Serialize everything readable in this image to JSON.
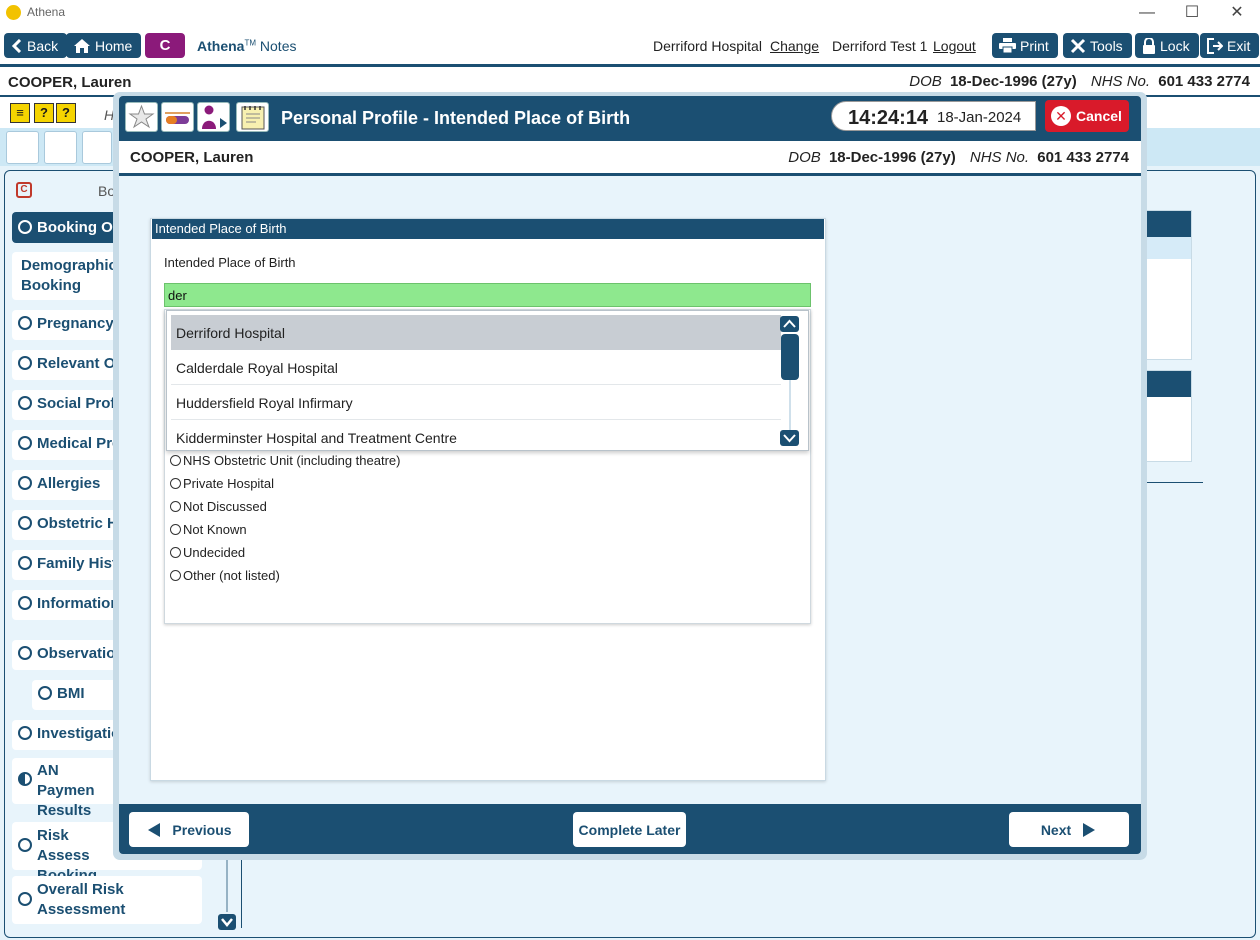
{
  "window": {
    "title": "Athena",
    "controls": {
      "minimize": "—",
      "maximize": "☐",
      "close": "✕"
    }
  },
  "toolbar": {
    "back_label": "Back",
    "home_label": "Home",
    "c_label": "C",
    "brand_name": "Athena",
    "brand_tm": "TM",
    "brand_suffix": "Notes",
    "hospital": "Derriford Hospital",
    "change_link": "Change",
    "user": "Derriford Test 1",
    "logout_link": "Logout",
    "print_label": "Print",
    "tools_label": "Tools",
    "lock_label": "Lock",
    "exit_label": "Exit"
  },
  "patient": {
    "name": "COOPER, Lauren",
    "dob_label": "DOB",
    "dob_value": "18-Dec-1996 (27y)",
    "nhs_label": "NHS No.",
    "nhs_value": "601 433 2774"
  },
  "background": {
    "c_badge": "C",
    "heading_fragment": "Bo",
    "h_fragment": "H",
    "nav_items": [
      {
        "label": "Booking Ov",
        "state": "active"
      },
      {
        "label": "Demographics Booking",
        "state": "none"
      },
      {
        "label": "Pregnancy I",
        "state": "empty"
      },
      {
        "label": "Relevant Ot",
        "state": "empty"
      },
      {
        "label": "Social Profil",
        "state": "empty"
      },
      {
        "label": "Medical Pro",
        "state": "empty"
      },
      {
        "label": "Allergies",
        "state": "empty"
      },
      {
        "label": "Obstetric H",
        "state": "empty"
      },
      {
        "label": "Family Histo",
        "state": "empty"
      },
      {
        "label": "Information",
        "state": "empty"
      },
      {
        "label": "Observation",
        "state": "empty"
      },
      {
        "label": "BMI",
        "state": "empty"
      },
      {
        "label": "Investigatio",
        "state": "empty"
      },
      {
        "label": "AN Paymen Results",
        "state": "half"
      },
      {
        "label": "Risk Assess Booking",
        "state": "empty"
      },
      {
        "label": "Overall Risk Assessment",
        "state": "empty"
      }
    ]
  },
  "modal": {
    "title": "Personal Profile - Intended Place of Birth",
    "time": "14:24:14",
    "date": "18-Jan-2024",
    "cancel_label": "Cancel",
    "card_header": "Intended Place of Birth",
    "field_label": "Intended Place of Birth",
    "search_value": "der",
    "dropdown_items": [
      "Derriford Hospital",
      "Calderdale Royal Hospital",
      "Huddersfield Royal Infirmary",
      "Kidderminster Hospital and Treatment Centre"
    ],
    "dropdown_selected_index": 0,
    "radio_options": [
      "NHS Obstetric Unit (including theatre)",
      "Private Hospital",
      "Not Discussed",
      "Not Known",
      "Undecided",
      "Other (not listed)"
    ],
    "footer": {
      "previous_label": "Previous",
      "complete_later_label": "Complete Later",
      "next_label": "Next"
    }
  },
  "colors": {
    "primary": "#1b4f72",
    "brand_purple": "#8b1a7a",
    "cancel_red": "#d91a2a",
    "input_green": "#8ee88e",
    "selected_row": "#c8cdd3"
  }
}
